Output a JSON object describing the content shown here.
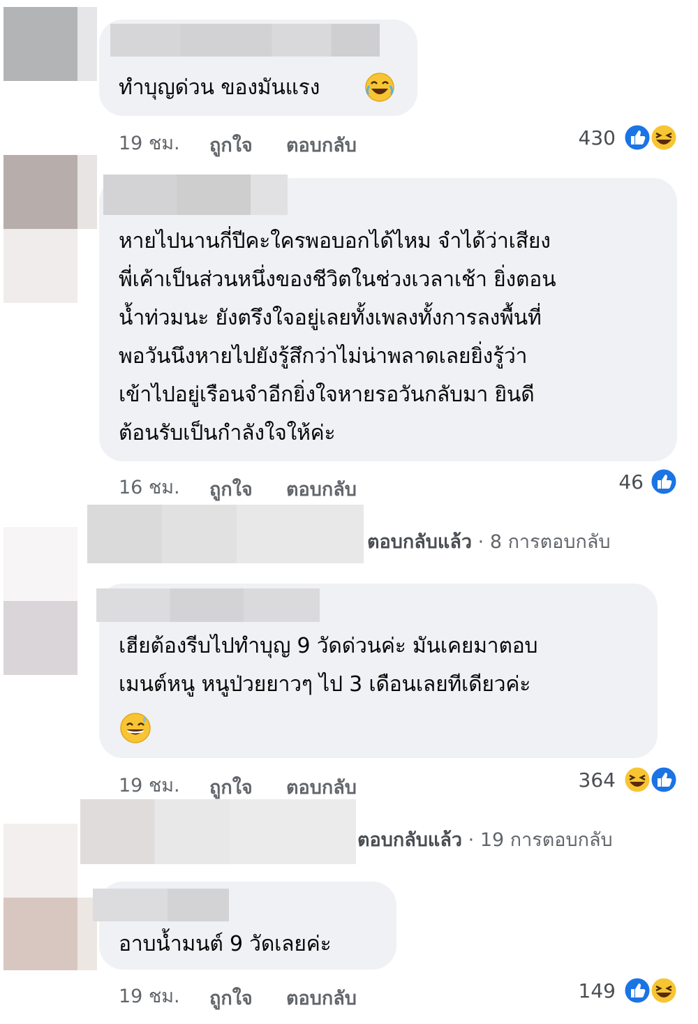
{
  "comments": [
    {
      "text": "ทำบุญด่วน ของมันแรง",
      "time": "19 ชม.",
      "like_label": "ถูกใจ",
      "reply_label": "ตอบกลับ",
      "reaction_count": "430",
      "reactions": [
        "like-icon",
        "haha-icon"
      ]
    },
    {
      "text": "หายไปนานกี่ปีคะใครพอบอกได้ไหม จำได้ว่าเสียง\nพี่เค้าเป็นส่วนหนึ่งของชีวิตในช่วงเวลาเช้า ยิ่งตอน\nน้ำท่วมนะ ยังตรึงใจอยู่เลยทั้งเพลงทั้งการลงพื้นที่\nพอวันนึงหายไปยังรู้สึกว่าไม่น่าพลาดเลยยิ่งรู้ว่า\nเข้าไปอยู่เรือนจำอีกยิ่งใจหายรอวันกลับมา ยินดี\nต้อนรับเป็นกำลังใจให้ค่ะ",
      "time": "16 ชม.",
      "like_label": "ถูกใจ",
      "reply_label": "ตอบกลับ",
      "reaction_count": "46",
      "reactions": [
        "like-icon"
      ],
      "replies_summary": {
        "replied_label": "ตอบกลับแล้ว",
        "separator": "·",
        "count_label": "8 การตอบกลับ"
      }
    },
    {
      "text": "เฮียต้องรีบไปทำบุญ 9 วัดด่วนค่ะ มันเคยมาตอบ\nเมนต์หนู หนูป่วยยาวๆ ไป 3 เดือนเลยทีเดียวค่ะ",
      "time": "19 ชม.",
      "like_label": "ถูกใจ",
      "reply_label": "ตอบกลับ",
      "reaction_count": "364",
      "reactions": [
        "haha-icon",
        "like-icon"
      ],
      "replies_summary": {
        "replied_label": "ตอบกลับแล้ว",
        "separator": "·",
        "count_label": "19 การตอบกลับ"
      }
    },
    {
      "text": "อาบน้ำมนต์ 9 วัดเลยค่ะ",
      "time": "19 ชม.",
      "like_label": "ถูกใจ",
      "reply_label": "ตอบกลับ",
      "reaction_count": "149",
      "reactions": [
        "like-icon",
        "haha-icon"
      ]
    }
  ],
  "colors": {
    "bubble_bg": "#eff1f4",
    "meta_text": "#62666b",
    "like_blue": "#1b74e4",
    "haha_yellow": "#f7c533"
  }
}
